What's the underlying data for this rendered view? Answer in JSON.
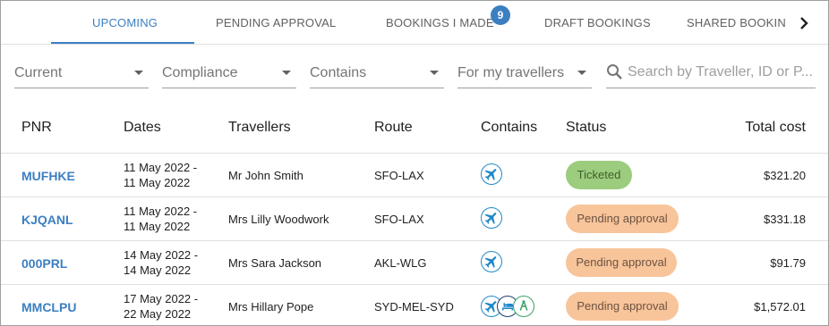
{
  "tabs": [
    {
      "label": "UPCOMING",
      "active": true
    },
    {
      "label": "PENDING APPROVAL"
    },
    {
      "label": "BOOKINGS I MADE",
      "badge": "9"
    },
    {
      "label": "DRAFT BOOKINGS"
    },
    {
      "label": "SHARED BOOKIN"
    }
  ],
  "filters": {
    "period": "Current",
    "compliance": "Compliance",
    "contains": "Contains",
    "travellers": "For my travellers",
    "search_placeholder": "Search by Traveller, ID or P..."
  },
  "columns": {
    "pnr": "PNR",
    "dates": "Dates",
    "travellers": "Travellers",
    "route": "Route",
    "contains": "Contains",
    "status": "Status",
    "total_cost": "Total cost"
  },
  "rows": [
    {
      "pnr": "MUFHKE",
      "date_from": "11 May 2022 -",
      "date_to": "11 May 2022",
      "traveller": "Mr John Smith",
      "route": "SFO-LAX",
      "contains": [
        "flight-icon"
      ],
      "status": "Ticketed",
      "cost": "$321.20"
    },
    {
      "pnr": "KJQANL",
      "date_from": "11 May 2022 -",
      "date_to": "11 May 2022",
      "traveller": "Mrs Lilly Woodwork",
      "route": "SFO-LAX",
      "contains": [
        "flight-icon"
      ],
      "status": "Pending approval",
      "cost": "$331.18"
    },
    {
      "pnr": "000PRL",
      "date_from": "14 May 2022 -",
      "date_to": "14 May 2022",
      "traveller": "Mrs Sara Jackson",
      "route": "AKL-WLG",
      "contains": [
        "flight-icon"
      ],
      "status": "Pending approval",
      "cost": "$91.79"
    },
    {
      "pnr": "MMCLPU",
      "date_from": "17 May 2022 -",
      "date_to": "22 May 2022",
      "traveller": "Mrs Hillary Pope",
      "route": "SYD-MEL-SYD",
      "contains": [
        "flight-icon",
        "hotel-icon",
        "car-icon"
      ],
      "status": "Pending approval",
      "cost": "$1,572.01"
    }
  ],
  "colors": {
    "accent": "#3c7fc1",
    "icon_blue": "#1e88c8",
    "icon_green": "#3aa064",
    "ticketed": "#9ccc7e",
    "pending": "#f8c49a"
  }
}
